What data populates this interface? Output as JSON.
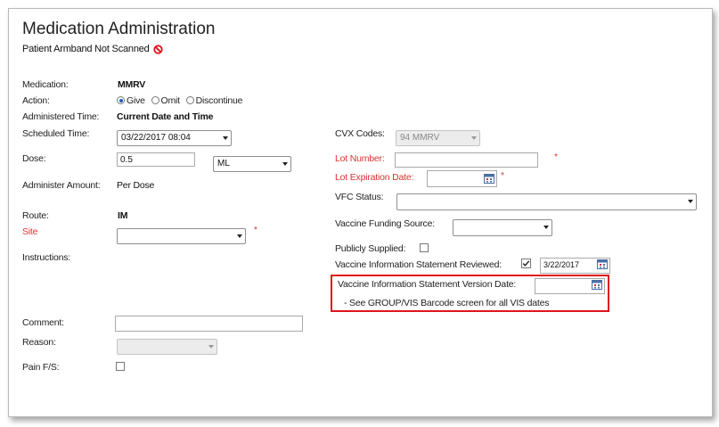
{
  "title": "Medication Administration",
  "patient_warning": "Patient Armband Not Scanned",
  "icons": {
    "no_scan": "prohibited-icon",
    "calendar": "calendar-icon"
  },
  "colors": {
    "required_label": "#d33333",
    "highlight_box": "#e0141e"
  },
  "left": {
    "medication_label": "Medication:",
    "medication_value": "MMRV",
    "action_label": "Action:",
    "action_options": [
      "Give",
      "Omit",
      "Discontinue"
    ],
    "action_selected": "Give",
    "administered_time_label": "Administered Time:",
    "administered_time_value": "Current Date and Time",
    "scheduled_time_label": "Scheduled Time:",
    "scheduled_time_value": "03/22/2017 08:04",
    "dose_label": "Dose:",
    "dose_value": "0.5",
    "dose_unit": "ML",
    "administer_amount_label": "Administer Amount:",
    "administer_amount_value": "Per Dose",
    "route_label": "Route:",
    "route_value": "IM",
    "site_label": "Site",
    "site_value": "",
    "instructions_label": "Instructions:",
    "comment_label": "Comment:",
    "comment_value": "",
    "reason_label": "Reason:",
    "reason_value": "",
    "pain_label": "Pain F/S:",
    "pain_checked": false
  },
  "right": {
    "cvx_label": "CVX Codes:",
    "cvx_value": "94 MMRV",
    "lot_number_label": "Lot Number:",
    "lot_number_value": "",
    "lot_exp_label": "Lot Expiration Date:",
    "lot_exp_value": "",
    "vfc_label": "VFC Status:",
    "vfc_value": "",
    "funding_label": "Vaccine Funding Source:",
    "funding_value": "",
    "publicly_supplied_label": "Publicly Supplied:",
    "publicly_supplied_checked": false,
    "vis_reviewed_label": "Vaccine Information Statement Reviewed:",
    "vis_reviewed_checked": true,
    "vis_reviewed_date": "3/22/2017",
    "vis_version_label": "Vaccine Information Statement Version Date:",
    "vis_version_value": "",
    "vis_note": "- See GROUP/VIS Barcode screen for all VIS dates"
  },
  "required_marker": "*"
}
